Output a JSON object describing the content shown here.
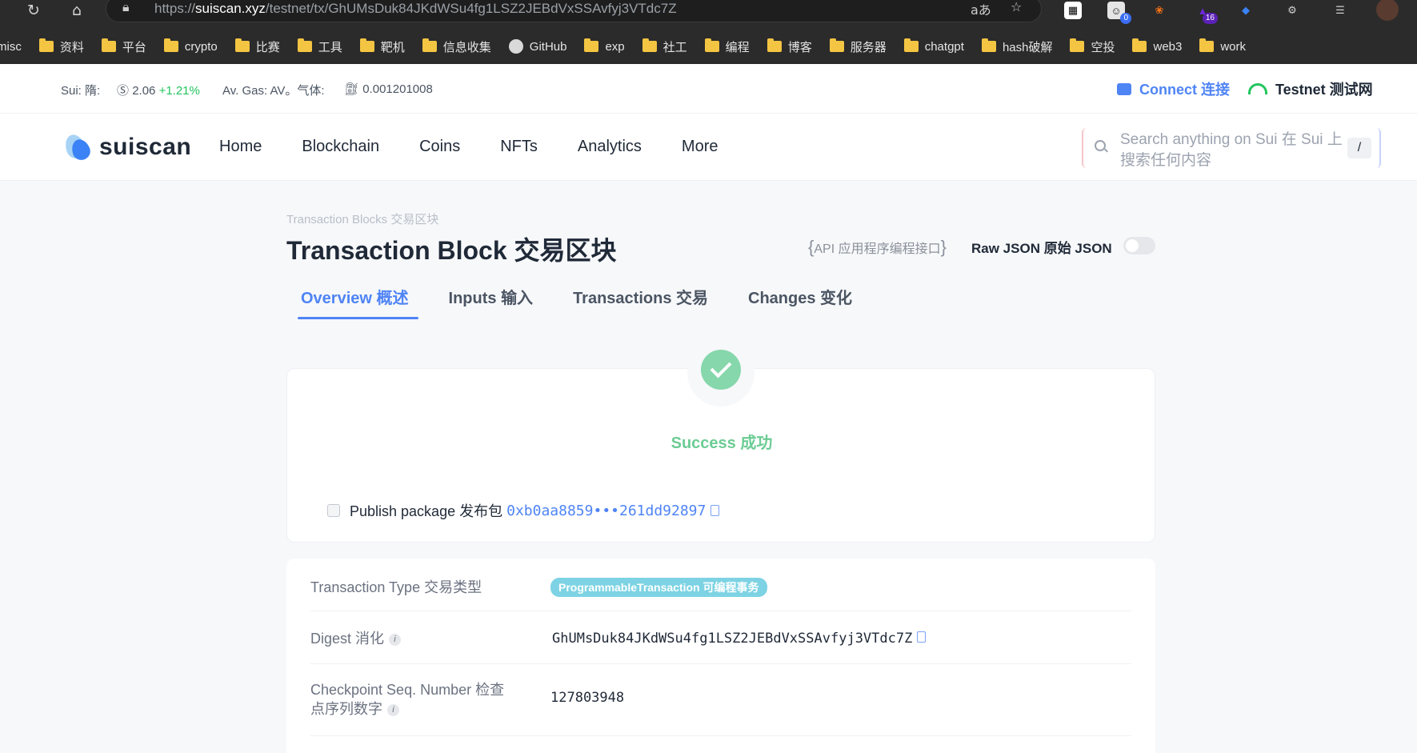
{
  "browser": {
    "url_host": "suiscan.xyz",
    "url_prefix": "https://",
    "url_path": "/testnet/tx/GhUMsDuk84JKdWSu4fg1LSZ2JEBdVxSSAvfyj3VTdc7Z",
    "ext_badge_1": "0",
    "ext_badge_2": "16",
    "bookmarks": [
      "misc",
      "资料",
      "平台",
      "crypto",
      "比赛",
      "工具",
      "靶机",
      "信息收集",
      "GitHub",
      "exp",
      "社工",
      "编程",
      "博客",
      "服务器",
      "chatgpt",
      "hash破解",
      "空投",
      "web3",
      "work"
    ]
  },
  "stats": {
    "sui_label": "Sui: 隋:",
    "sui_price": "2.06",
    "sui_change": "+1.21%",
    "gas_label": "Av. Gas: AV。气体:",
    "gas_value": "0.001201008",
    "connect": "Connect 连接",
    "network": "Testnet 测试网"
  },
  "nav": {
    "logo": "suiscan",
    "links": [
      "Home",
      "Blockchain",
      "Coins",
      "NFTs",
      "Analytics",
      "More"
    ],
    "search_placeholder": "Search anything on Sui 在 Sui 上搜索任何内容",
    "search_shortcut": "/"
  },
  "page": {
    "breadcrumb": "Transaction Blocks 交易区块",
    "title": "Transaction Block  交易区块",
    "api_label": "API 应用程序编程接口",
    "raw_json_label": "Raw JSON 原始 JSON",
    "raw_json_enabled": false,
    "tabs": [
      "Overview 概述",
      "Inputs 输入",
      "Transactions 交易",
      "Changes 变化"
    ],
    "active_tab": "Overview 概述"
  },
  "status": {
    "text": "Success 成功",
    "publish_label": "Publish package 发布包",
    "package_id": "0xb0aa8859•••261dd92897"
  },
  "details": {
    "rows": [
      {
        "label": "Transaction Type 交易类型",
        "value": "ProgrammableTransaction 可编程事务"
      },
      {
        "label": "Digest 消化",
        "value": "GhUMsDuk84JKdWSu4fg1LSZ2JEBdVxSSAvfyj3VTdc7Z"
      },
      {
        "label": "Checkpoint Seq. Number 检查点序列数字",
        "value": "127803948"
      }
    ]
  },
  "colors": {
    "accent": "#4f84f5",
    "success": "#6ccc94",
    "positive": "#22c55e",
    "pill": "#7dd3e3"
  }
}
